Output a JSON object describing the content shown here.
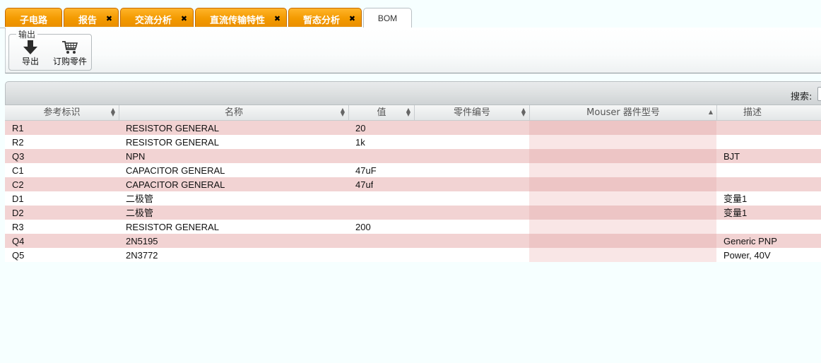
{
  "tabs": [
    {
      "label": "子电路",
      "closable": false
    },
    {
      "label": "报告",
      "closable": true
    },
    {
      "label": "交流分析",
      "closable": true
    },
    {
      "label": "直流传输特性",
      "closable": true
    },
    {
      "label": "暂态分析",
      "closable": true
    },
    {
      "label": "BOM",
      "closable": false,
      "active": true
    }
  ],
  "close_glyph": "✖",
  "toolbar": {
    "group_title": "输出",
    "export_label": "导出",
    "order_label": "订购零件"
  },
  "grid": {
    "search_label": "搜索:",
    "search_value": "",
    "columns": [
      "参考标识",
      "名称",
      "值",
      "零件编号",
      "Mouser 器件型号",
      "描述"
    ],
    "sorted_column": "Mouser 器件型号",
    "rows": [
      [
        "R1",
        "RESISTOR GENERAL",
        "20",
        "",
        "",
        ""
      ],
      [
        "R2",
        "RESISTOR GENERAL",
        "1k",
        "",
        "",
        ""
      ],
      [
        "Q3",
        "NPN",
        "",
        "",
        "",
        "BJT"
      ],
      [
        "C1",
        "CAPACITOR GENERAL",
        "47uF",
        "",
        "",
        ""
      ],
      [
        "C2",
        "CAPACITOR GENERAL",
        "47uf",
        "",
        "",
        ""
      ],
      [
        "D1",
        "二极管",
        "",
        "",
        "",
        "变量1"
      ],
      [
        "D2",
        "二极管",
        "",
        "",
        "",
        "变量1"
      ],
      [
        "R3",
        "RESISTOR GENERAL",
        "200",
        "",
        "",
        ""
      ],
      [
        "Q4",
        "2N5195",
        "",
        "",
        "",
        "Generic PNP"
      ],
      [
        "Q5",
        "2N3772",
        "",
        "",
        "",
        "Power, 40V"
      ]
    ]
  },
  "colors": {
    "tab_orange": "#f39a00",
    "row_pink": "#f2d3d3",
    "sorted_col": "#edc5c5"
  }
}
